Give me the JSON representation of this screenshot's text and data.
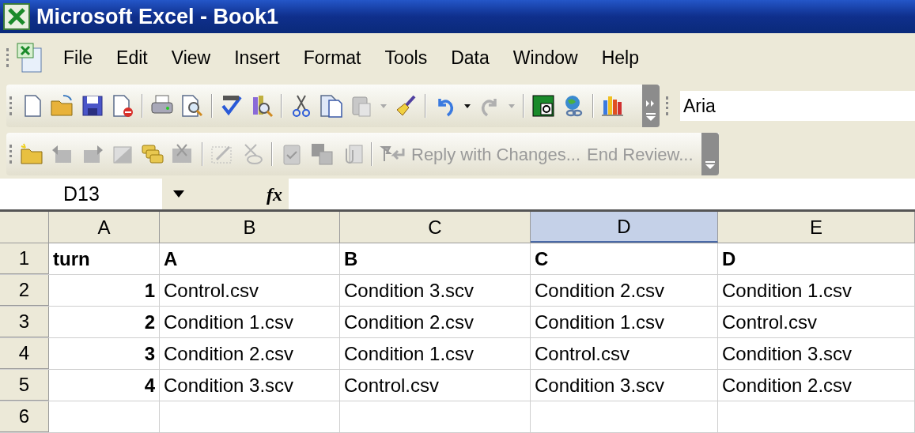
{
  "window": {
    "title": "Microsoft Excel - Book1"
  },
  "menu": [
    {
      "label": "File"
    },
    {
      "label": "Edit"
    },
    {
      "label": "View"
    },
    {
      "label": "Insert"
    },
    {
      "label": "Format"
    },
    {
      "label": "Tools"
    },
    {
      "label": "Data"
    },
    {
      "label": "Window"
    },
    {
      "label": "Help"
    }
  ],
  "font_box": {
    "value": "Aria"
  },
  "review_toolbar": [
    {
      "label": "Reply with Changes...",
      "disabled": true
    },
    {
      "label": "End Review...",
      "disabled": true
    }
  ],
  "formula_bar": {
    "name_box": "D13",
    "function_label": "fx"
  },
  "columns": [
    {
      "label": "A",
      "selected": false
    },
    {
      "label": "B",
      "selected": false
    },
    {
      "label": "C",
      "selected": false
    },
    {
      "label": "D",
      "selected": true
    },
    {
      "label": "E",
      "selected": false
    }
  ],
  "rows": [
    {
      "label": "1",
      "cells": [
        {
          "text": "turn",
          "kind": "text",
          "bold": true
        },
        {
          "text": "A",
          "kind": "text",
          "bold": true
        },
        {
          "text": "B",
          "kind": "text",
          "bold": true
        },
        {
          "text": "C",
          "kind": "text",
          "bold": true
        },
        {
          "text": "D",
          "kind": "text",
          "bold": true
        }
      ]
    },
    {
      "label": "2",
      "cells": [
        {
          "text": "1",
          "kind": "number",
          "bold": true
        },
        {
          "text": "Control.csv",
          "kind": "text",
          "bold": false
        },
        {
          "text": "Condition 3.scv",
          "kind": "text",
          "bold": false
        },
        {
          "text": "Condition 2.csv",
          "kind": "text",
          "bold": false
        },
        {
          "text": "Condition 1.csv",
          "kind": "text",
          "bold": false
        }
      ]
    },
    {
      "label": "3",
      "cells": [
        {
          "text": "2",
          "kind": "number",
          "bold": true
        },
        {
          "text": "Condition 1.csv",
          "kind": "text",
          "bold": false
        },
        {
          "text": "Condition 2.csv",
          "kind": "text",
          "bold": false
        },
        {
          "text": "Condition 1.csv",
          "kind": "text",
          "bold": false
        },
        {
          "text": "Control.csv",
          "kind": "text",
          "bold": false
        }
      ]
    },
    {
      "label": "4",
      "cells": [
        {
          "text": "3",
          "kind": "number",
          "bold": true
        },
        {
          "text": "Condition 2.csv",
          "kind": "text",
          "bold": false
        },
        {
          "text": "Condition 1.csv",
          "kind": "text",
          "bold": false
        },
        {
          "text": "Control.csv",
          "kind": "text",
          "bold": false
        },
        {
          "text": "Condition 3.scv",
          "kind": "text",
          "bold": false
        }
      ]
    },
    {
      "label": "5",
      "cells": [
        {
          "text": "4",
          "kind": "number",
          "bold": true
        },
        {
          "text": "Condition 3.scv",
          "kind": "text",
          "bold": false
        },
        {
          "text": "Control.csv",
          "kind": "text",
          "bold": false
        },
        {
          "text": "Condition 3.scv",
          "kind": "text",
          "bold": false
        },
        {
          "text": "Condition 2.csv",
          "kind": "text",
          "bold": false
        }
      ]
    },
    {
      "label": "6",
      "cells": []
    }
  ]
}
